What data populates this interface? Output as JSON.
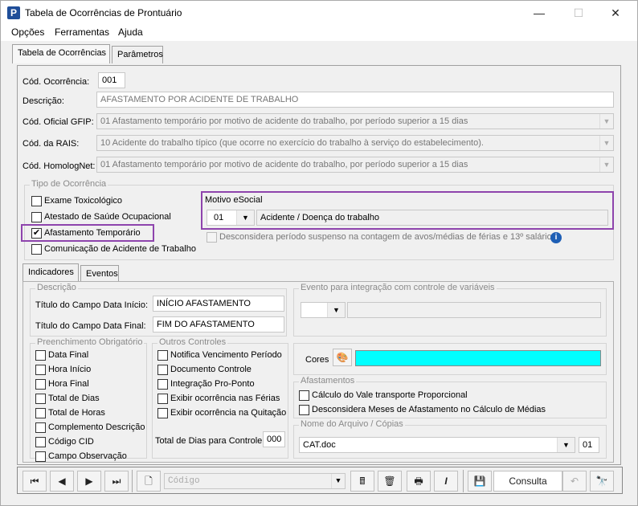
{
  "window": {
    "title": "Tabela de Ocorrências de Prontuário",
    "app_icon": "P",
    "minimize": "—",
    "maximize": "☐",
    "close": "✕"
  },
  "menu": [
    "Opções",
    "Ferramentas",
    "Ajuda"
  ],
  "main_tabs": [
    "Tabela de Ocorrências",
    "Parâmetros"
  ],
  "form": {
    "cod_ocorrencia_label": "Cód. Ocorrência:",
    "cod_ocorrencia_value": "001",
    "descricao_label": "Descrição:",
    "descricao_value": "AFASTAMENTO POR ACIDENTE DE TRABALHO",
    "gfip_label": "Cód. Oficial GFIP:",
    "gfip_value": "01 Afastamento temporário por motivo de acidente do trabalho, por período superior a 15 dias",
    "rais_label": "Cód. da RAIS:",
    "rais_value": "10 Acidente do trabalho típico (que ocorre no exercício do trabalho à serviço do estabelecimento).",
    "homolognet_label": "Cód. HomologNet:",
    "homolognet_value": "01  Afastamento temporário por motivo de acidente do trabalho, por período superior a 15 dias"
  },
  "tipo_ocorrencia": {
    "title": "Tipo de Ocorrência",
    "items": [
      {
        "label": "Exame Toxicológico",
        "checked": false
      },
      {
        "label": "Atestado de Saúde Ocupacional",
        "checked": false
      },
      {
        "label": "Afastamento Temporário",
        "checked": true
      },
      {
        "label": "Comunicação de Acidente de Trabalho",
        "checked": false
      }
    ],
    "motivo_label": "Motivo eSocial",
    "motivo_code": "01",
    "motivo_desc": "Acidente / Doença do trabalho",
    "desconsidera_label": "Desconsidera período suspenso na contagem de avos/médias de férias e 13º salário?"
  },
  "sub_tabs": [
    "Indicadores",
    "Eventos"
  ],
  "descricao_group": {
    "title": "Descrição",
    "inicio_label": "Título do Campo Data Início:",
    "inicio_value": "INÍCIO AFASTAMENTO",
    "final_label": "Título do Campo Data Final:",
    "final_value": "FIM DO AFASTAMENTO"
  },
  "evento_group": {
    "title": "Evento para integração com controle de variáveis"
  },
  "preenchimento": {
    "title": "Preenchimento Obrigatório",
    "items": [
      "Data Final",
      "Hora Início",
      "Hora Final",
      "Total de Dias",
      "Total de Horas",
      "Complemento Descrição",
      "Código CID",
      "Campo Observação"
    ]
  },
  "outros": {
    "title": "Outros Controles",
    "items": [
      "Notifica Vencimento Período",
      "Documento Controle",
      "Integração Pro-Ponto",
      "Exibir ocorrência nas Férias",
      "Exibir ocorrência na Quitação"
    ],
    "total_label": "Total de Dias para Controle:",
    "total_value": "000"
  },
  "cores": {
    "label": "Cores",
    "color": "#00ffff"
  },
  "afastamentos": {
    "title": "Afastamentos",
    "items": [
      "Cálculo do Vale transporte Proporcional",
      "Desconsidera Meses de Afastamento no Cálculo de Médias"
    ]
  },
  "arquivo": {
    "title": "Nome do Arquivo / Cópias",
    "file": "CAT.doc",
    "copies": "01"
  },
  "toolbar": {
    "codigo_placeholder": "Código",
    "consulta_label": "Consulta"
  },
  "colors": {
    "highlight": "#8e44ad",
    "accent": "#1e5fb5"
  }
}
